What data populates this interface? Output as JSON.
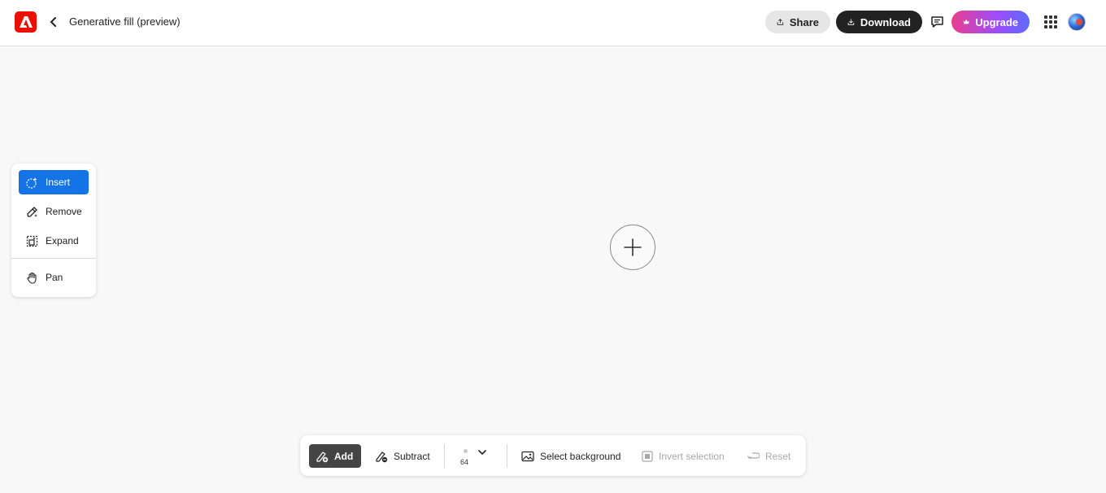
{
  "header": {
    "title": "Generative fill (preview)",
    "share_label": "Share",
    "download_label": "Download",
    "upgrade_label": "Upgrade"
  },
  "tools": {
    "items": [
      {
        "label": "Insert",
        "icon": "insert-sparkle-icon",
        "active": true
      },
      {
        "label": "Remove",
        "icon": "eraser-icon",
        "active": false
      },
      {
        "label": "Expand",
        "icon": "expand-icon",
        "active": false
      },
      {
        "label": "Pan",
        "icon": "hand-icon",
        "active": false
      }
    ]
  },
  "toolbar": {
    "add_label": "Add",
    "subtract_label": "Subtract",
    "brush_size": "64",
    "select_background_label": "Select background",
    "invert_selection_label": "Invert selection",
    "reset_label": "Reset"
  },
  "colors": {
    "accent": "#1473e6",
    "brand": "#eb1000",
    "dark": "#222222"
  }
}
